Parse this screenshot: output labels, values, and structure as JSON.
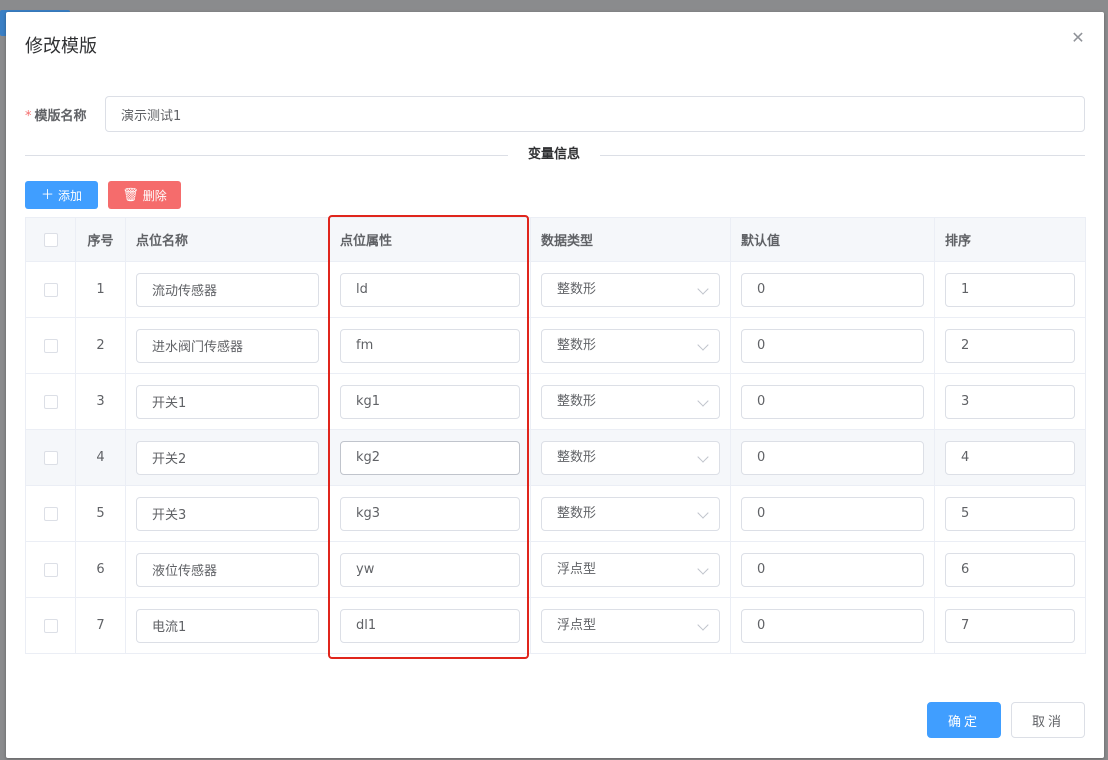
{
  "dialog": {
    "title": "修改模版",
    "close_icon": "close-icon"
  },
  "form": {
    "required_mark": "*",
    "name_label": "模版名称",
    "name_value": "演示测试1"
  },
  "section": {
    "divider_text": "变量信息"
  },
  "toolbar": {
    "add_icon": "plus-icon",
    "add_label": "添加",
    "delete_icon": "trash-icon",
    "delete_label": "删除"
  },
  "table": {
    "headers": {
      "index": "序号",
      "name": "点位名称",
      "attr": "点位属性",
      "type": "数据类型",
      "default": "默认值",
      "sort": "排序"
    },
    "rows": [
      {
        "index": "1",
        "name": "流动传感器",
        "attr": "ld",
        "type": "整数形",
        "default": "0",
        "sort": "1"
      },
      {
        "index": "2",
        "name": "进水阀门传感器",
        "attr": "fm",
        "type": "整数形",
        "default": "0",
        "sort": "2"
      },
      {
        "index": "3",
        "name": "开关1",
        "attr": "kg1",
        "type": "整数形",
        "default": "0",
        "sort": "3"
      },
      {
        "index": "4",
        "name": "开关2",
        "attr": "kg2",
        "type": "整数形",
        "default": "0",
        "sort": "4"
      },
      {
        "index": "5",
        "name": "开关3",
        "attr": "kg3",
        "type": "整数形",
        "default": "0",
        "sort": "5"
      },
      {
        "index": "6",
        "name": "液位传感器",
        "attr": "yw",
        "type": "浮点型",
        "default": "0",
        "sort": "6"
      },
      {
        "index": "7",
        "name": "电流1",
        "attr": "dl1",
        "type": "浮点型",
        "default": "0",
        "sort": "7"
      }
    ]
  },
  "footer": {
    "confirm_label": "确定",
    "cancel_label": "取消"
  },
  "colors": {
    "primary": "#409eff",
    "danger": "#f56c6c",
    "highlight": "#e0251c"
  }
}
